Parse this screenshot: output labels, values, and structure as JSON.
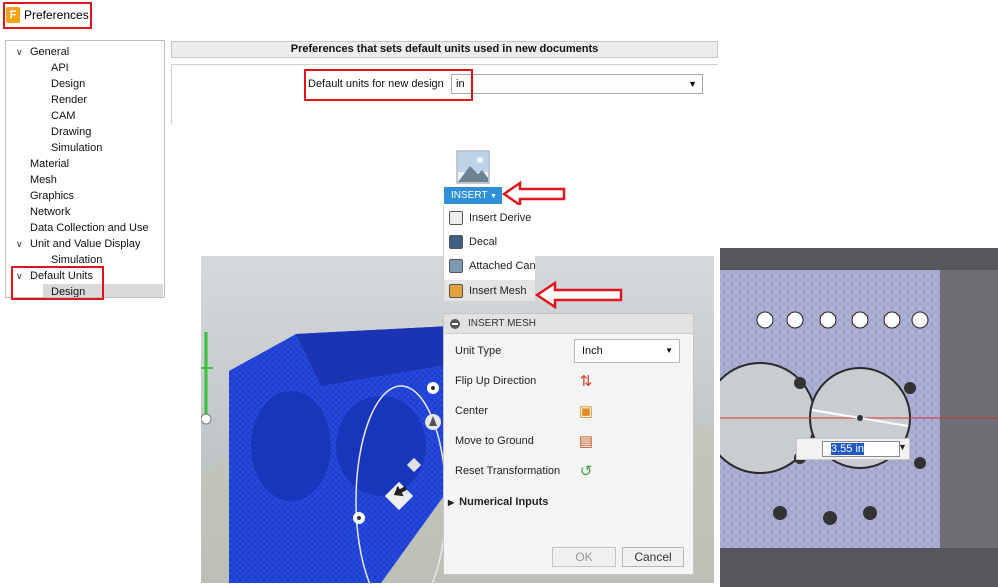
{
  "preferences": {
    "title": "Preferences",
    "app_icon": "F",
    "tree": [
      {
        "label": "General",
        "level": 0,
        "expanded": true
      },
      {
        "label": "API",
        "level": 2
      },
      {
        "label": "Design",
        "level": 2
      },
      {
        "label": "Render",
        "level": 2
      },
      {
        "label": "CAM",
        "level": 2
      },
      {
        "label": "Drawing",
        "level": 2
      },
      {
        "label": "Simulation",
        "level": 2
      },
      {
        "label": "Material",
        "level": 1
      },
      {
        "label": "Mesh",
        "level": 1
      },
      {
        "label": "Graphics",
        "level": 1
      },
      {
        "label": "Network",
        "level": 1
      },
      {
        "label": "Data Collection and Use",
        "level": 1
      },
      {
        "label": "Unit and Value Display",
        "level": 0,
        "expanded": true
      },
      {
        "label": "Simulation",
        "level": 2
      },
      {
        "label": "Default Units",
        "level": 0,
        "expanded": true
      },
      {
        "label": "Design",
        "level": 2,
        "selected": true
      }
    ],
    "header": "Preferences that sets default units used in new documents",
    "units_label": "Default units for new design",
    "units_value": "in"
  },
  "insert_menu": {
    "button": "INSERT",
    "items": [
      "Insert Derive",
      "Decal",
      "Attached Can",
      "Insert Mesh"
    ]
  },
  "insert_mesh": {
    "title": "INSERT MESH",
    "unit_type_label": "Unit Type",
    "unit_type_value": "Inch",
    "rows": [
      "Flip Up Direction",
      "Center",
      "Move to Ground",
      "Reset Transformation"
    ],
    "numerical_inputs": "Numerical Inputs",
    "ok": "OK",
    "cancel": "Cancel"
  },
  "dimension": {
    "value": "3.55 in"
  },
  "colors": {
    "highlight_red": "#e0141c",
    "accent_blue": "#2f8fd8",
    "mesh_blue": "#1f3fd0"
  }
}
